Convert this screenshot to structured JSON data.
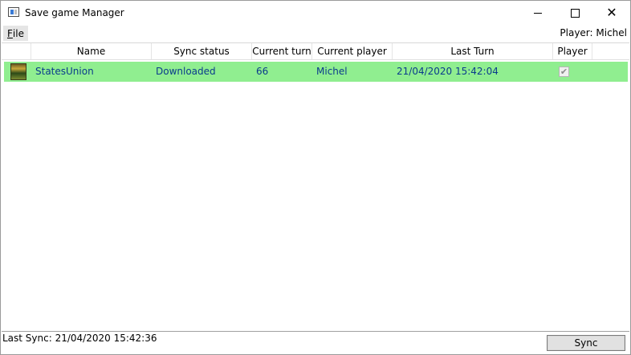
{
  "window": {
    "title": "Save game Manager",
    "minimize_icon": "minimize-icon",
    "maximize_icon": "maximize-icon",
    "close_icon": "close-icon",
    "close_glyph": "✕"
  },
  "menu": {
    "file_underlined": "F",
    "file_rest": "ile"
  },
  "player_label": "Player:  Michel",
  "table": {
    "columns": [
      "Name",
      "Sync status",
      "Current turn",
      "Current player",
      "Last Turn",
      "Player"
    ],
    "rows": [
      {
        "icon": "game-thumbnail-icon",
        "name": "StatesUnion",
        "sync_status": "Downloaded",
        "current_turn": "66",
        "current_player": "Michel",
        "last_turn": "21/04/2020 15:42:04",
        "player_checked": true,
        "check_glyph": "✔"
      }
    ],
    "row_highlight_color": "#90ee90"
  },
  "status": {
    "last_sync": "Last Sync: 21/04/2020 15:42:36"
  },
  "buttons": {
    "sync": "Sync"
  }
}
